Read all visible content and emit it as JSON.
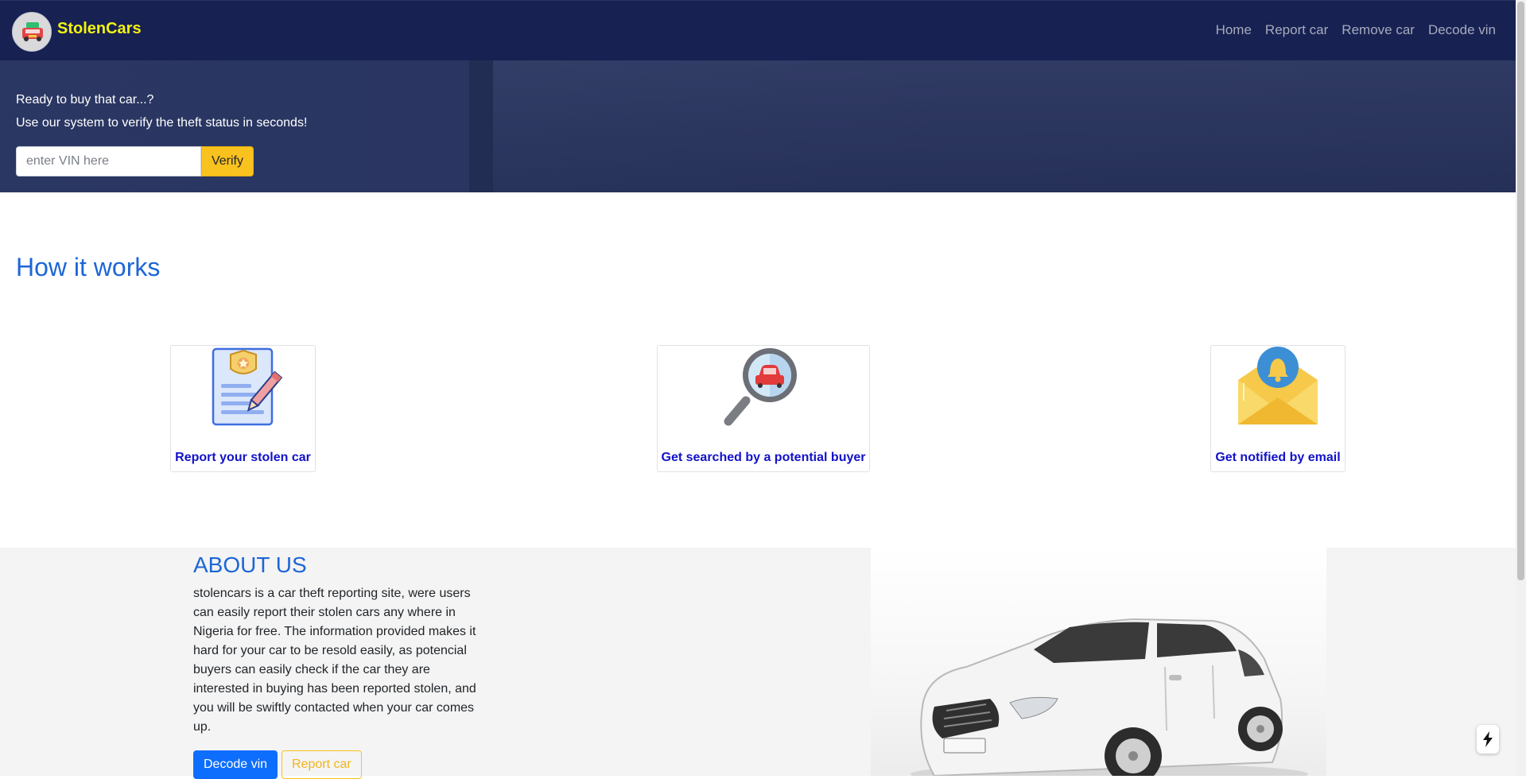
{
  "navbar": {
    "brand": "StolenCars",
    "links": [
      "Home",
      "Report car",
      "Remove car",
      "Decode vin"
    ]
  },
  "hero": {
    "line1": "Ready to buy that car...?",
    "line2": "Use our system to verify the theft status in seconds!",
    "vin_placeholder": "enter VIN here",
    "verify_label": "Verify"
  },
  "how_it_works": {
    "title": "How it works",
    "cards": [
      {
        "title": "Report your stolen car",
        "icon": "report-document-icon"
      },
      {
        "title": "Get searched by a potential buyer",
        "icon": "magnifier-car-icon"
      },
      {
        "title": "Get notified by email",
        "icon": "envelope-bell-icon"
      }
    ]
  },
  "about": {
    "title": "ABOUT US",
    "text": "stolencars is a car theft reporting site, were users can easily report their stolen cars any where in Nigeria for free. The information provided makes it hard for your car to be resold easily, as potencial buyers can easily check if the car they are interested in buying has been reported stolen, and you will be swiftly contacted when your car comes up.",
    "decode_label": "Decode vin",
    "report_label": "Report car"
  },
  "colors": {
    "navbar": "#172152",
    "brand": "#f3f312",
    "accent_blue": "#1d66d6",
    "card_title": "#1212c8",
    "warning": "#f9c21e",
    "primary": "#0d6efd"
  }
}
